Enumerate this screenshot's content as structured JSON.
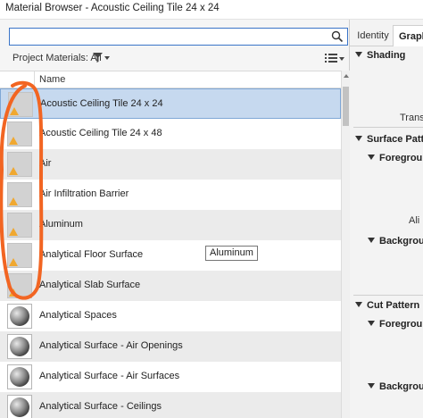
{
  "window": {
    "title": "Material Browser - Acoustic Ceiling Tile 24 x 24"
  },
  "search": {
    "placeholder": "",
    "icon": "search-icon"
  },
  "filter": {
    "label": "Project Materials: All"
  },
  "list": {
    "column_header": "Name",
    "selected_index": 0,
    "items": [
      {
        "label": "Acoustic Ceiling Tile 24 x 24",
        "thumb": "flat"
      },
      {
        "label": "Acoustic Ceiling Tile 24 x 48",
        "thumb": "flat"
      },
      {
        "label": "Air",
        "thumb": "flat"
      },
      {
        "label": "Air Infiltration Barrier",
        "thumb": "flat"
      },
      {
        "label": "Aluminum",
        "thumb": "flat"
      },
      {
        "label": "Analytical Floor Surface",
        "thumb": "flat"
      },
      {
        "label": "Analytical Slab Surface",
        "thumb": "flat"
      },
      {
        "label": "Analytical Spaces",
        "thumb": "sphere"
      },
      {
        "label": "Analytical Surface - Air Openings",
        "thumb": "sphere"
      },
      {
        "label": "Analytical Surface - Air Surfaces",
        "thumb": "sphere"
      },
      {
        "label": "Analytical Surface - Ceilings",
        "thumb": "sphere"
      }
    ]
  },
  "tooltip": {
    "text": "Aluminum"
  },
  "properties": {
    "tabs": [
      "Identity",
      "Graph"
    ],
    "active_tab": 1,
    "shading": "Shading",
    "transparency": "Transp",
    "surface_pattern": "Surface Patter",
    "foreground_1": "Foregroun",
    "align": "Ali",
    "background_1": "Backgroun",
    "cut_pattern": "Cut Pattern",
    "foreground_2": "Foregroun",
    "background_2": "Backgroun"
  },
  "colors": {
    "selection": "#c6d9ef",
    "search_border": "#3a74c8",
    "annotation": "#f26522",
    "warning_triangle": "#f0a830"
  }
}
